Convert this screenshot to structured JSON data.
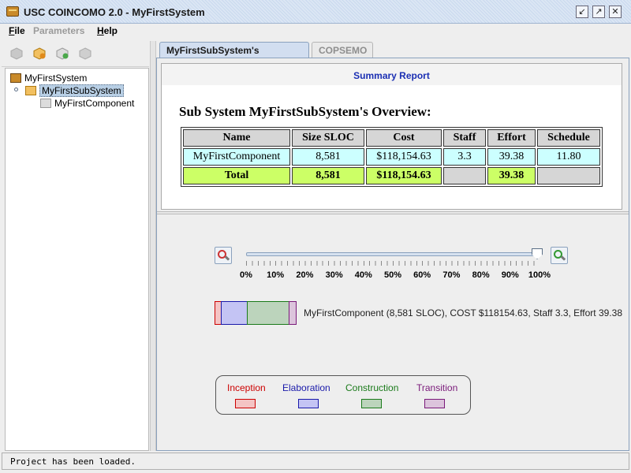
{
  "window": {
    "title": "USC COINCOMO 2.0 - MyFirstSystem"
  },
  "menu": [
    {
      "label": "File",
      "mnemonic": "F",
      "rest": "ile",
      "enabled": true
    },
    {
      "label": "Parameters",
      "mnemonic": "",
      "rest": "Parameters",
      "enabled": false
    },
    {
      "label": "Help",
      "mnemonic": "H",
      "rest": "elp",
      "enabled": true
    }
  ],
  "toolbar": {
    "icons": [
      "system-icon",
      "add-subsystem-icon",
      "add-component-icon",
      "component-icon"
    ]
  },
  "tree": {
    "root": "MyFirstSystem",
    "subsystem": "MyFirstSubSystem",
    "component": "MyFirstComponent"
  },
  "tabs": [
    {
      "label": "MyFirstSubSystem's Overview",
      "active": true
    },
    {
      "label": "COPSEMO",
      "active": false
    }
  ],
  "report": {
    "summary_title": "Summary Report",
    "overview_title": "Sub System MyFirstSubSystem's Overview:",
    "headers": [
      "Name",
      "Size SLOC",
      "Cost",
      "Staff",
      "Effort",
      "Schedule"
    ],
    "rows": [
      [
        "MyFirstComponent",
        "8,581",
        "$118,154.63",
        "3.3",
        "39.38",
        "11.80"
      ]
    ],
    "total": [
      "Total",
      "8,581",
      "$118,154.63",
      "",
      "39.38",
      ""
    ]
  },
  "slider": {
    "value_percent": 100,
    "labels": [
      "0%",
      "10%",
      "20%",
      "30%",
      "40%",
      "50%",
      "60%",
      "70%",
      "80%",
      "90%",
      "100%"
    ]
  },
  "component_bar": {
    "label": "MyFirstComponent (8,581 SLOC), COST $118154.63, Staff 3.3, Effort 39.38"
  },
  "legend": {
    "items": [
      {
        "label": "Inception",
        "color": "#cc0000",
        "fill": "#f4c4c4"
      },
      {
        "label": "Elaboration",
        "color": "#1a1aaa",
        "fill": "#c4c4f4"
      },
      {
        "label": "Construction",
        "color": "#1a7a1a",
        "fill": "#bcd4bc"
      },
      {
        "label": "Transition",
        "color": "#7a1a7a",
        "fill": "#dcc4dc"
      }
    ]
  },
  "status": {
    "text": "Project has been loaded."
  }
}
